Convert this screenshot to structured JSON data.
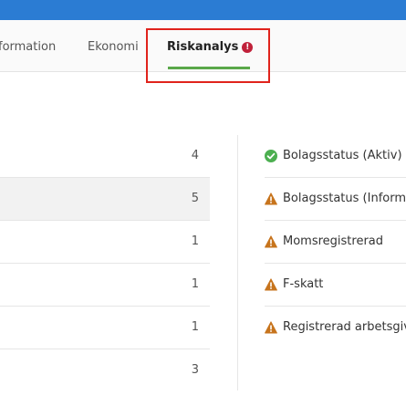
{
  "tabs": [
    {
      "label": "formation",
      "active": false
    },
    {
      "label": "Ekonomi",
      "active": false
    },
    {
      "label": "Riskanalys",
      "active": true,
      "alert": "!"
    }
  ],
  "counts": [
    "4",
    "5",
    "1",
    "1",
    "1",
    "3"
  ],
  "checks": [
    {
      "label": "Bolagsstatus (Aktiv)",
      "icon": "check-circle-icon",
      "status": "ok"
    },
    {
      "label": "Bolagsstatus (Informa",
      "icon": "warning-icon",
      "status": "warning"
    },
    {
      "label": "Momsregistrerad",
      "icon": "warning-icon",
      "status": "warning"
    },
    {
      "label": "F-skatt",
      "icon": "warning-icon",
      "status": "warning"
    },
    {
      "label": "Registrerad arbetsgiva",
      "icon": "warning-icon",
      "status": "warning"
    }
  ],
  "colors": {
    "topbar": "#2b7cd3",
    "active_underline": "#5aa84a",
    "highlight_box": "#e0231c",
    "ok": "#4caf50",
    "warning": "#c7741d",
    "alert": "#c0213a"
  }
}
